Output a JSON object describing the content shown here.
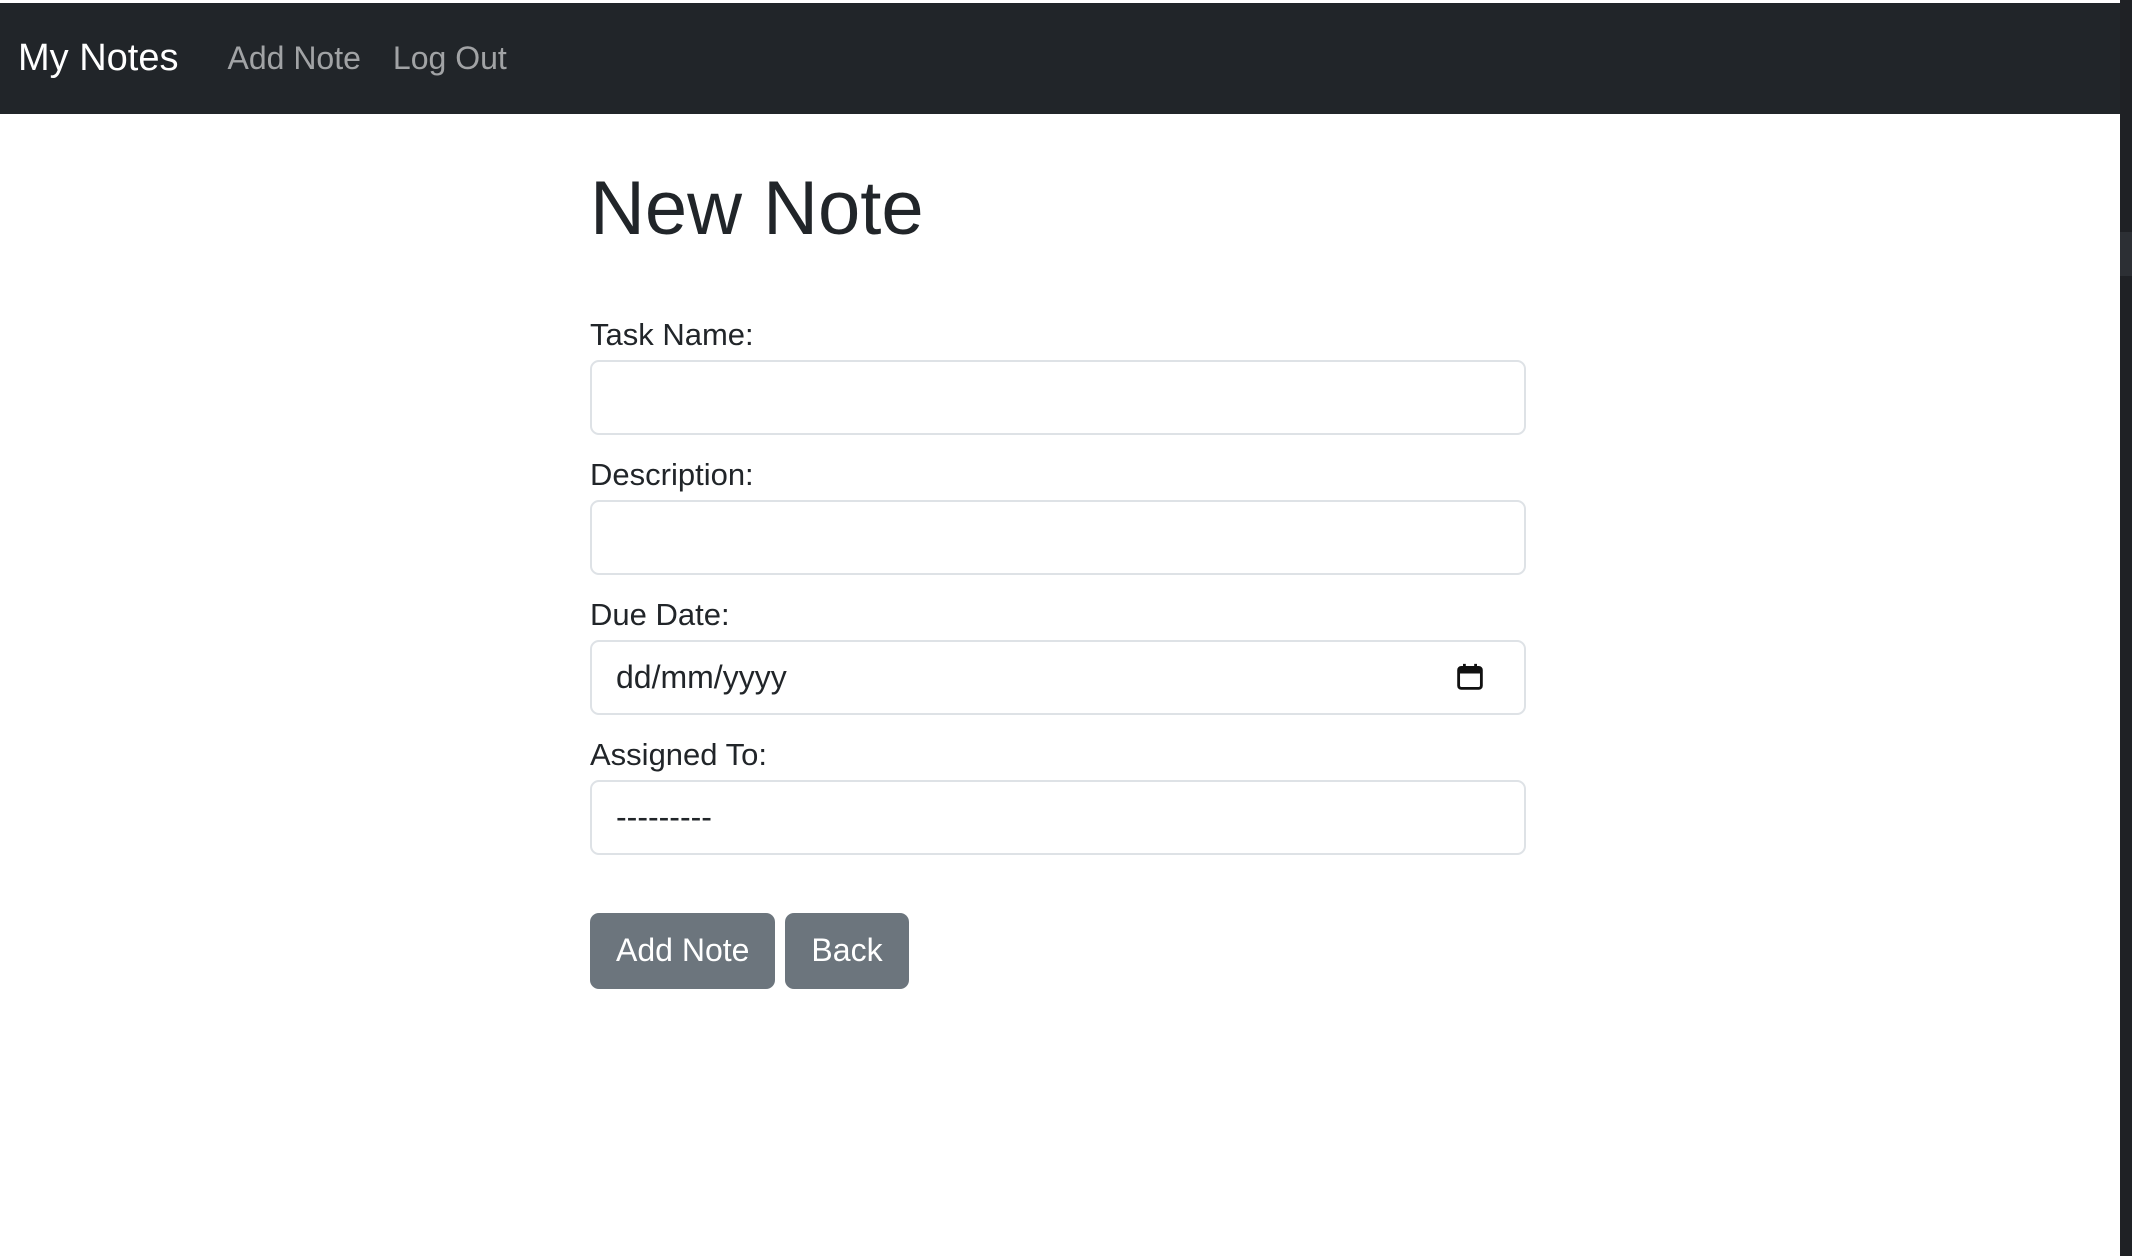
{
  "navbar": {
    "brand": "My Notes",
    "links": [
      {
        "label": "Add Note"
      },
      {
        "label": "Log Out"
      }
    ]
  },
  "page": {
    "title": "New Note"
  },
  "form": {
    "task_name": {
      "label": "Task Name:",
      "value": ""
    },
    "description": {
      "label": "Description:",
      "value": ""
    },
    "due_date": {
      "label": "Due Date:",
      "placeholder": "dd/mm/yyyy",
      "icon": "calendar-icon"
    },
    "assigned_to": {
      "label": "Assigned To:",
      "selected": "---------"
    },
    "submit_label": "Add Note",
    "back_label": "Back"
  },
  "colors": {
    "navbar_bg": "#212529",
    "button_bg": "#6c757d"
  }
}
